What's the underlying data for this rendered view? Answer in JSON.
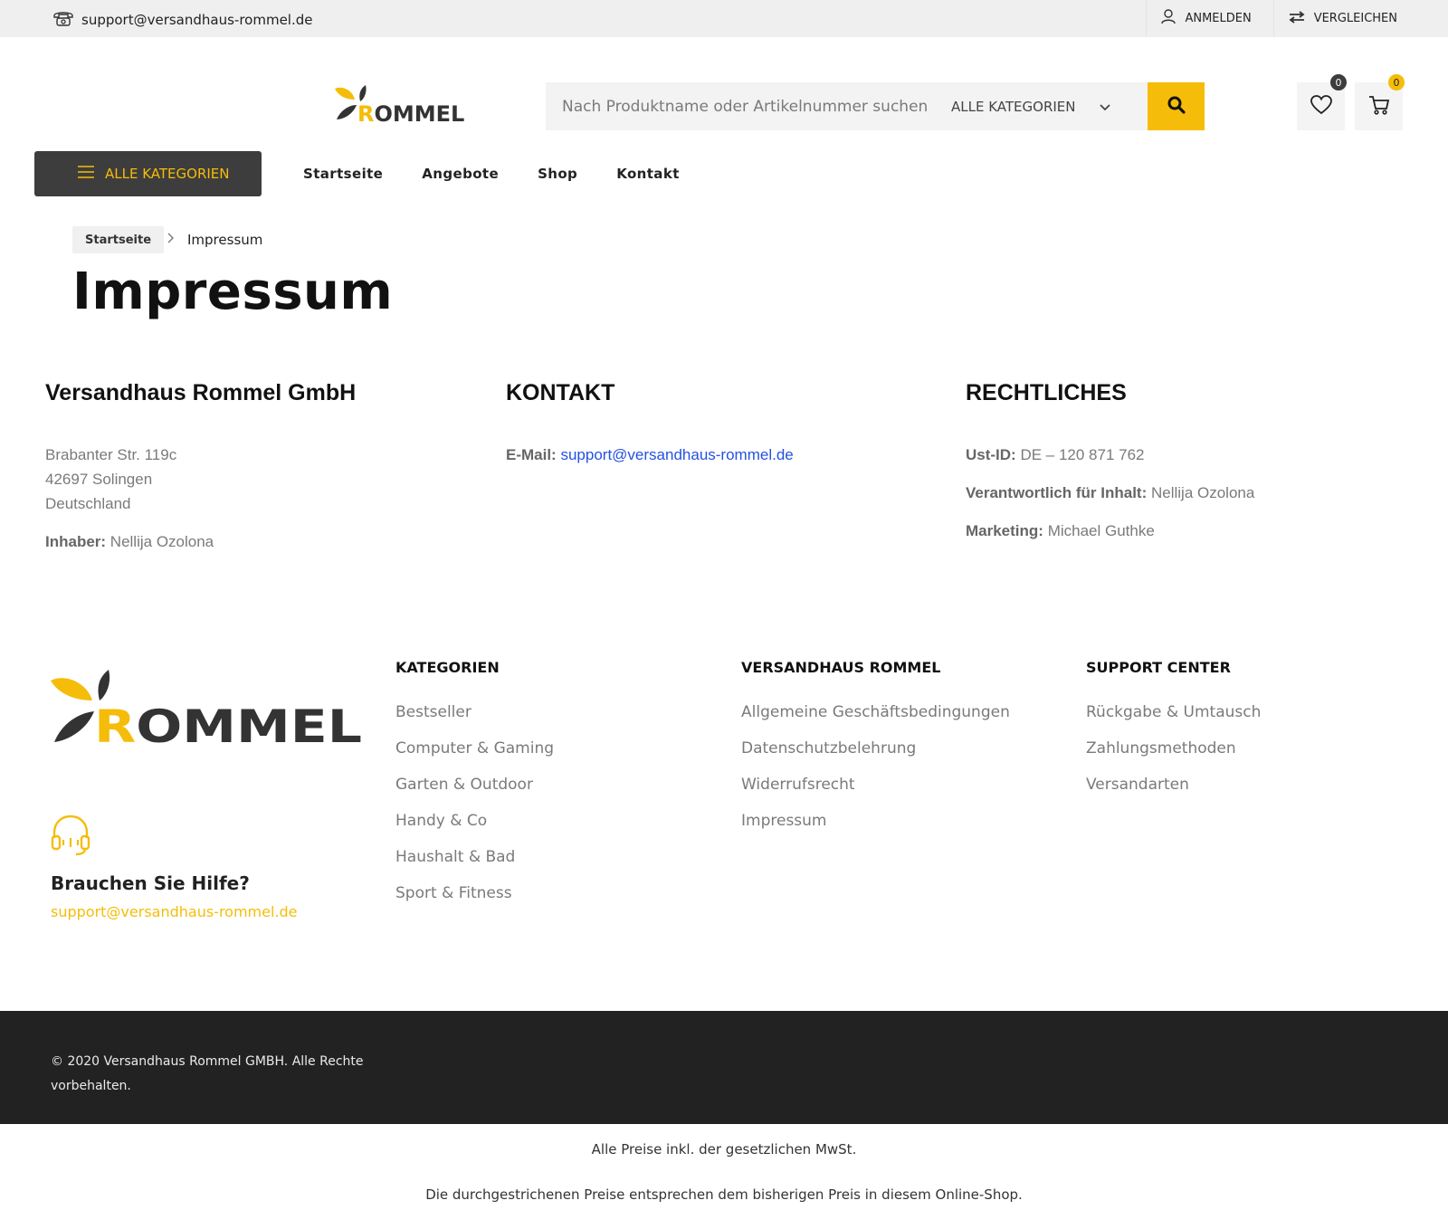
{
  "topbar": {
    "email": "support@versandhaus-rommel.de",
    "login_label": "ANMELDEN",
    "compare_label": "VERGLEICHEN",
    "icons": {
      "phone": "phone-icon",
      "user": "user-icon",
      "compare": "compare-arrows-icon"
    }
  },
  "header": {
    "logo_text": "ROMMEL",
    "search_placeholder": "Nach Produktname oder Artikelnummer suchen",
    "category_select": "ALLE KATEGORIEN",
    "wishlist_count": "0",
    "cart_count": "0"
  },
  "nav": {
    "all_categories_label": "ALLE KATEGORIEN",
    "items": [
      "Startseite",
      "Angebote",
      "Shop",
      "Kontakt"
    ]
  },
  "breadcrumb": {
    "home": "Startseite",
    "current": "Impressum"
  },
  "page": {
    "title": "Impressum",
    "company": {
      "heading": "Versandhaus Rommel GmbH",
      "street": "Brabanter Str. 119c",
      "city": "42697 Solingen",
      "country": "Deutschland",
      "owner_label": "Inhaber:",
      "owner": "Nellija Ozolona"
    },
    "contact": {
      "heading": "KONTAKT",
      "email_label": "E-Mail:",
      "email": "support@versandhaus-rommel.de"
    },
    "legal": {
      "heading": "RECHTLICHES",
      "vat_label": "Ust-ID:",
      "vat": "DE – 120 871 762",
      "responsible_label": "Verantwortlich für Inhalt:",
      "responsible": "Nellija Ozolona",
      "marketing_label": "Marketing:",
      "marketing": "Michael Guthke"
    }
  },
  "footer": {
    "logo_text": "ROMMEL",
    "help_title": "Brauchen Sie Hilfe?",
    "help_email": "support@versandhaus-rommel.de",
    "columns": [
      {
        "heading": "KATEGORIEN",
        "links": [
          "Bestseller",
          "Computer & Gaming",
          "Garten & Outdoor",
          "Handy & Co",
          "Haushalt & Bad",
          "Sport & Fitness"
        ]
      },
      {
        "heading": "VERSANDHAUS ROMMEL",
        "links": [
          "Allgemeine Geschäftsbedingungen",
          "Datenschutzbelehrung",
          "Widerrufsrecht",
          "Impressum"
        ]
      },
      {
        "heading": "SUPPORT CENTER",
        "links": [
          "Rückgabe & Umtausch",
          "Zahlungsmethoden",
          "Versandarten"
        ]
      }
    ],
    "copyright": "© 2020 Versandhaus Rommel GMBH. Alle Rechte vorbehalten.",
    "note_vat": "Alle Preise inkl. der gesetzlichen MwSt.",
    "note_prices": "Die durchgestrichenen Preise entsprechen dem bisherigen Preis in diesem Online-Shop."
  },
  "colors": {
    "accent": "#f5bd09",
    "dark": "#3d3d3d",
    "footer_bg": "#222222",
    "link": "#2452e0"
  }
}
